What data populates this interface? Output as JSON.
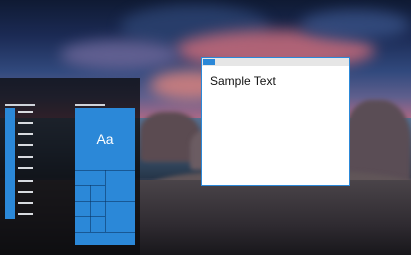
{
  "window": {
    "content_text": "Sample Text"
  },
  "start_menu": {
    "tile_label": "Aa"
  },
  "colors": {
    "accent": "#2b88d8",
    "window_bg": "#ffffff",
    "start_menu_bg": "#0c0c0e"
  }
}
